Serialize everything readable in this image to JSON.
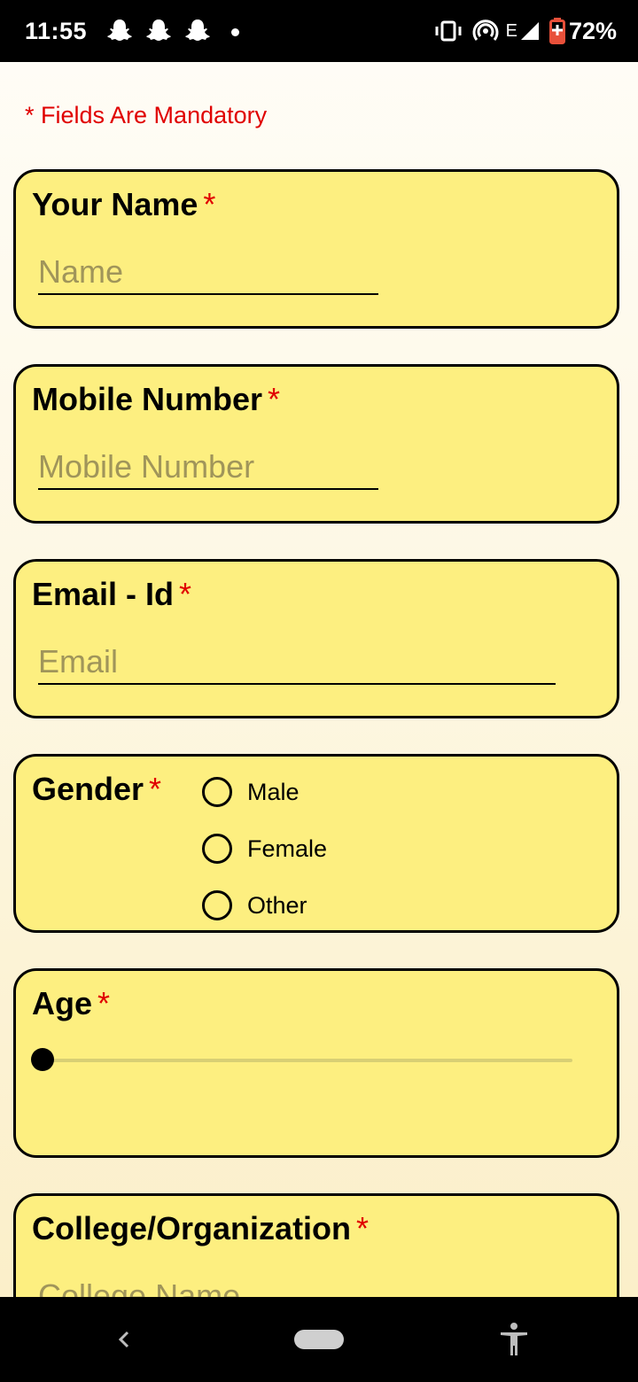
{
  "status_bar": {
    "time": "11:55",
    "network_type": "E",
    "battery": "72%",
    "icons": [
      "snapchat-icon",
      "snapchat-icon",
      "snapchat-icon",
      "dot-icon",
      "vibrate-icon",
      "hotspot-icon",
      "signal-icon",
      "battery-saver-icon"
    ]
  },
  "form": {
    "mandatory_note": "* Fields Are Mandatory",
    "required_marker": "*",
    "name": {
      "label": "Your Name",
      "placeholder": "Name",
      "value": ""
    },
    "mobile": {
      "label": "Mobile Number",
      "placeholder": "Mobile Number",
      "value": ""
    },
    "email": {
      "label": "Email - Id",
      "placeholder": "Email",
      "value": ""
    },
    "gender": {
      "label": "Gender",
      "options": [
        "Male",
        "Female",
        "Other"
      ],
      "selected": null
    },
    "age": {
      "label": "Age",
      "value_fraction": 0
    },
    "college": {
      "label": "College/Organization",
      "placeholder": "College Name",
      "value": ""
    }
  },
  "colors": {
    "card_background": "#fdef80",
    "required_red": "#e00000",
    "placeholder": "#a0955a"
  },
  "nav_bar": {
    "icons": [
      "back-icon",
      "home-pill-icon",
      "accessibility-icon"
    ]
  }
}
